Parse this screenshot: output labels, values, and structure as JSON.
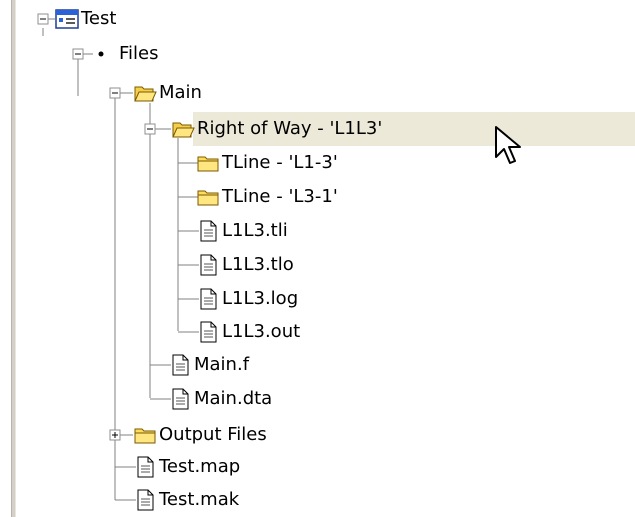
{
  "colors": {
    "background": "#ffffff",
    "tree_line": "#808080",
    "expander_border": "#8f8f8f",
    "folder_fill": "#ffdc5c",
    "folder_edge": "#7a5a00",
    "hover_row": "#ece9d8",
    "project_icon": "#2c62d8"
  },
  "tree": {
    "root": {
      "label": "Test",
      "icon": "project-icon",
      "expander": "minus"
    },
    "files": {
      "label": "Files",
      "icon": "dot-icon",
      "expander": "minus"
    },
    "main": {
      "label": "Main",
      "icon": "folder-open-icon",
      "expander": "minus"
    },
    "row": {
      "label": "Right of Way - 'L1L3'",
      "icon": "folder-open-icon",
      "expander": "minus"
    },
    "row_children": [
      {
        "label": "TLine - 'L1-3'",
        "icon": "folder-icon"
      },
      {
        "label": "TLine - 'L3-1'",
        "icon": "folder-icon"
      },
      {
        "label": "L1L3.tli",
        "icon": "file-icon"
      },
      {
        "label": "L1L3.tlo",
        "icon": "file-icon"
      },
      {
        "label": "L1L3.log",
        "icon": "file-icon"
      },
      {
        "label": "L1L3.out",
        "icon": "file-icon"
      }
    ],
    "main_files": [
      {
        "label": "Main.f",
        "icon": "file-icon"
      },
      {
        "label": "Main.dta",
        "icon": "file-icon"
      }
    ],
    "output_files": {
      "label": "Output Files",
      "icon": "folder-icon",
      "expander": "plus"
    },
    "root_files": [
      {
        "label": "Test.map",
        "icon": "file-icon"
      },
      {
        "label": "Test.mak",
        "icon": "file-icon"
      }
    ]
  }
}
